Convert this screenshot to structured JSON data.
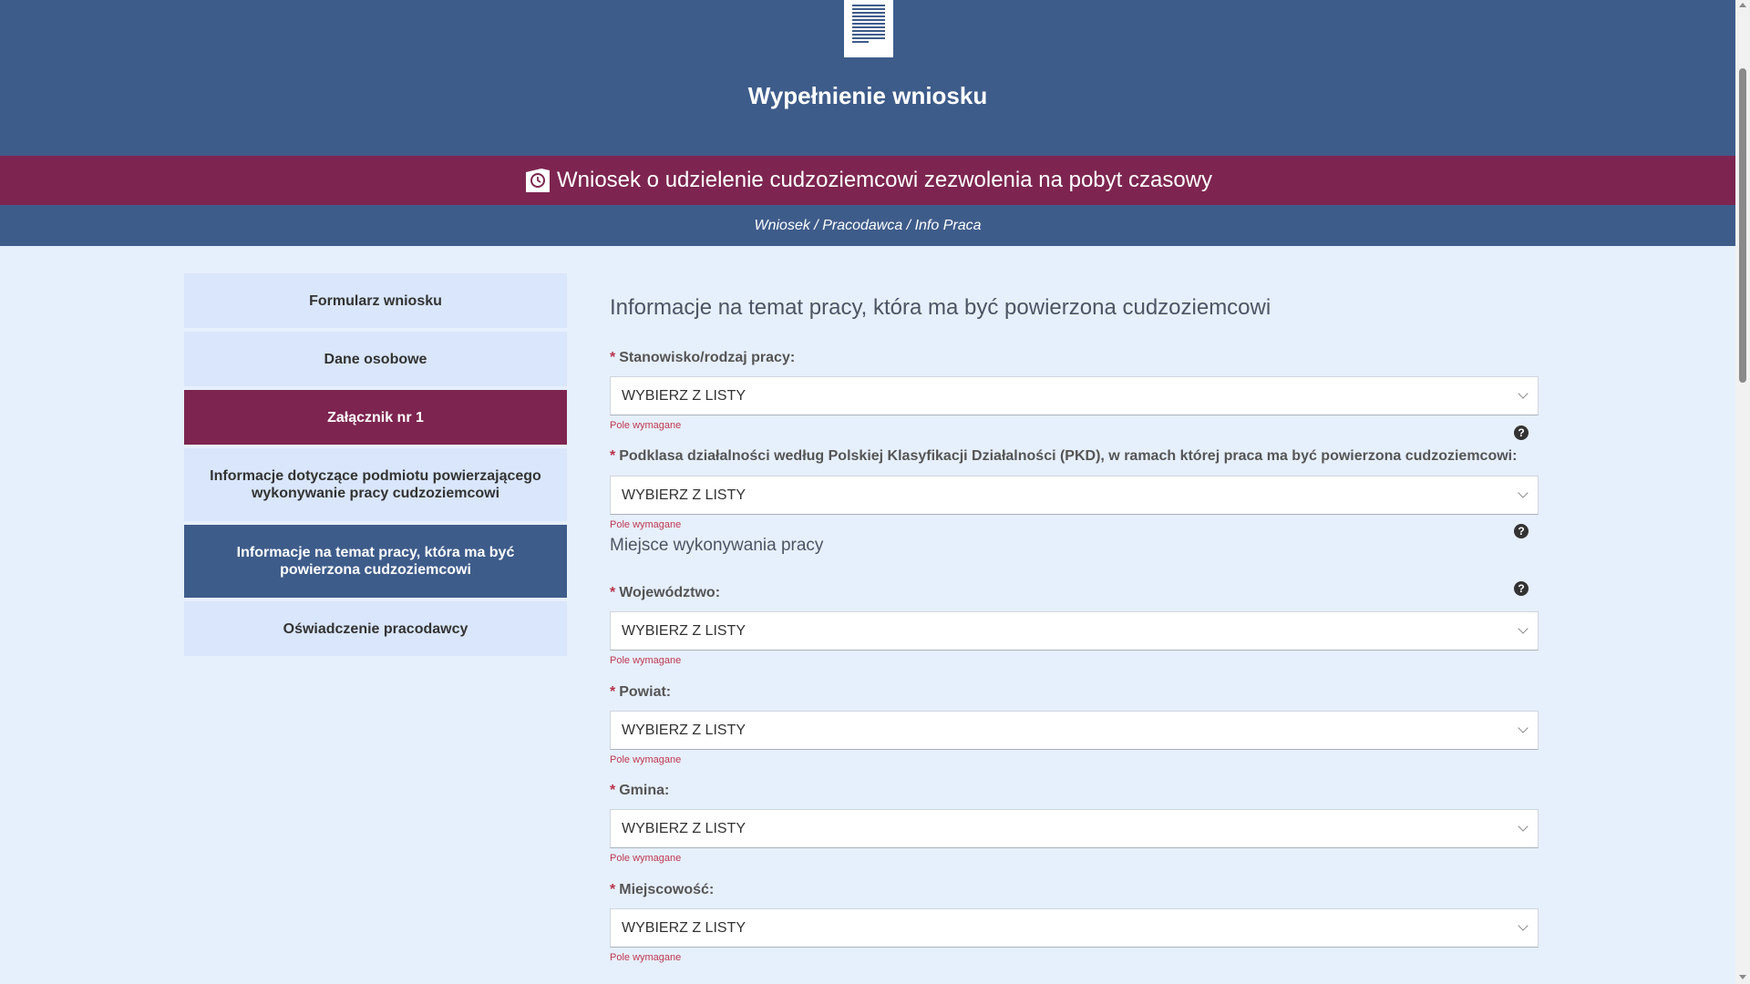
{
  "header": {
    "title": "Wypełnienie wniosku",
    "doc_icon": "document-icon"
  },
  "banner": {
    "title": "Wniosek o udzielenie cudzoziemcowi zezwolenia na pobyt czasowy",
    "icon": "clock-icon"
  },
  "breadcrumb": "Wniosek / Pracodawca / Info Praca",
  "sidebar": {
    "items": [
      {
        "label": "Formularz wniosku"
      },
      {
        "label": "Dane osobowe"
      },
      {
        "label": "Załącznik nr 1"
      },
      {
        "label": "Informacje dotyczące podmiotu powierzającego wykonywanie pracy cudzoziemcowi"
      },
      {
        "label": "Informacje na temat pracy, która ma być powierzona cudzoziemcowi"
      },
      {
        "label": "Oświadczenie pracodawcy"
      }
    ]
  },
  "main": {
    "section_title": "Informacje na temat pracy, która ma być powierzona cudzoziemcowi",
    "subsection_title": "Miejsce wykonywania pracy",
    "required_marker": "*",
    "help_glyph": "?",
    "fields": [
      {
        "label": "Stanowisko/rodzaj pracy:",
        "value": "WYBIERZ Z LISTY",
        "error": "Pole wymagane"
      },
      {
        "label": "Podklasa działalności według Polskiej Klasyfikacji Działalności (PKD), w ramach której praca ma być powierzona cudzoziemcowi:",
        "value": "WYBIERZ Z LISTY",
        "error": "Pole wymagane"
      },
      {
        "label": "Województwo:",
        "value": "WYBIERZ Z LISTY",
        "error": "Pole wymagane"
      },
      {
        "label": "Powiat:",
        "value": "WYBIERZ Z LISTY",
        "error": "Pole wymagane"
      },
      {
        "label": "Gmina:",
        "value": "WYBIERZ Z LISTY",
        "error": "Pole wymagane"
      },
      {
        "label": "Miejscowość:",
        "value": "WYBIERZ Z LISTY",
        "error": "Pole wymagane"
      }
    ]
  },
  "colors": {
    "header_blue": "#3e5c8a",
    "banner_maroon": "#7d2550",
    "page_bg": "#e6effc",
    "error_red": "#c0394f"
  }
}
